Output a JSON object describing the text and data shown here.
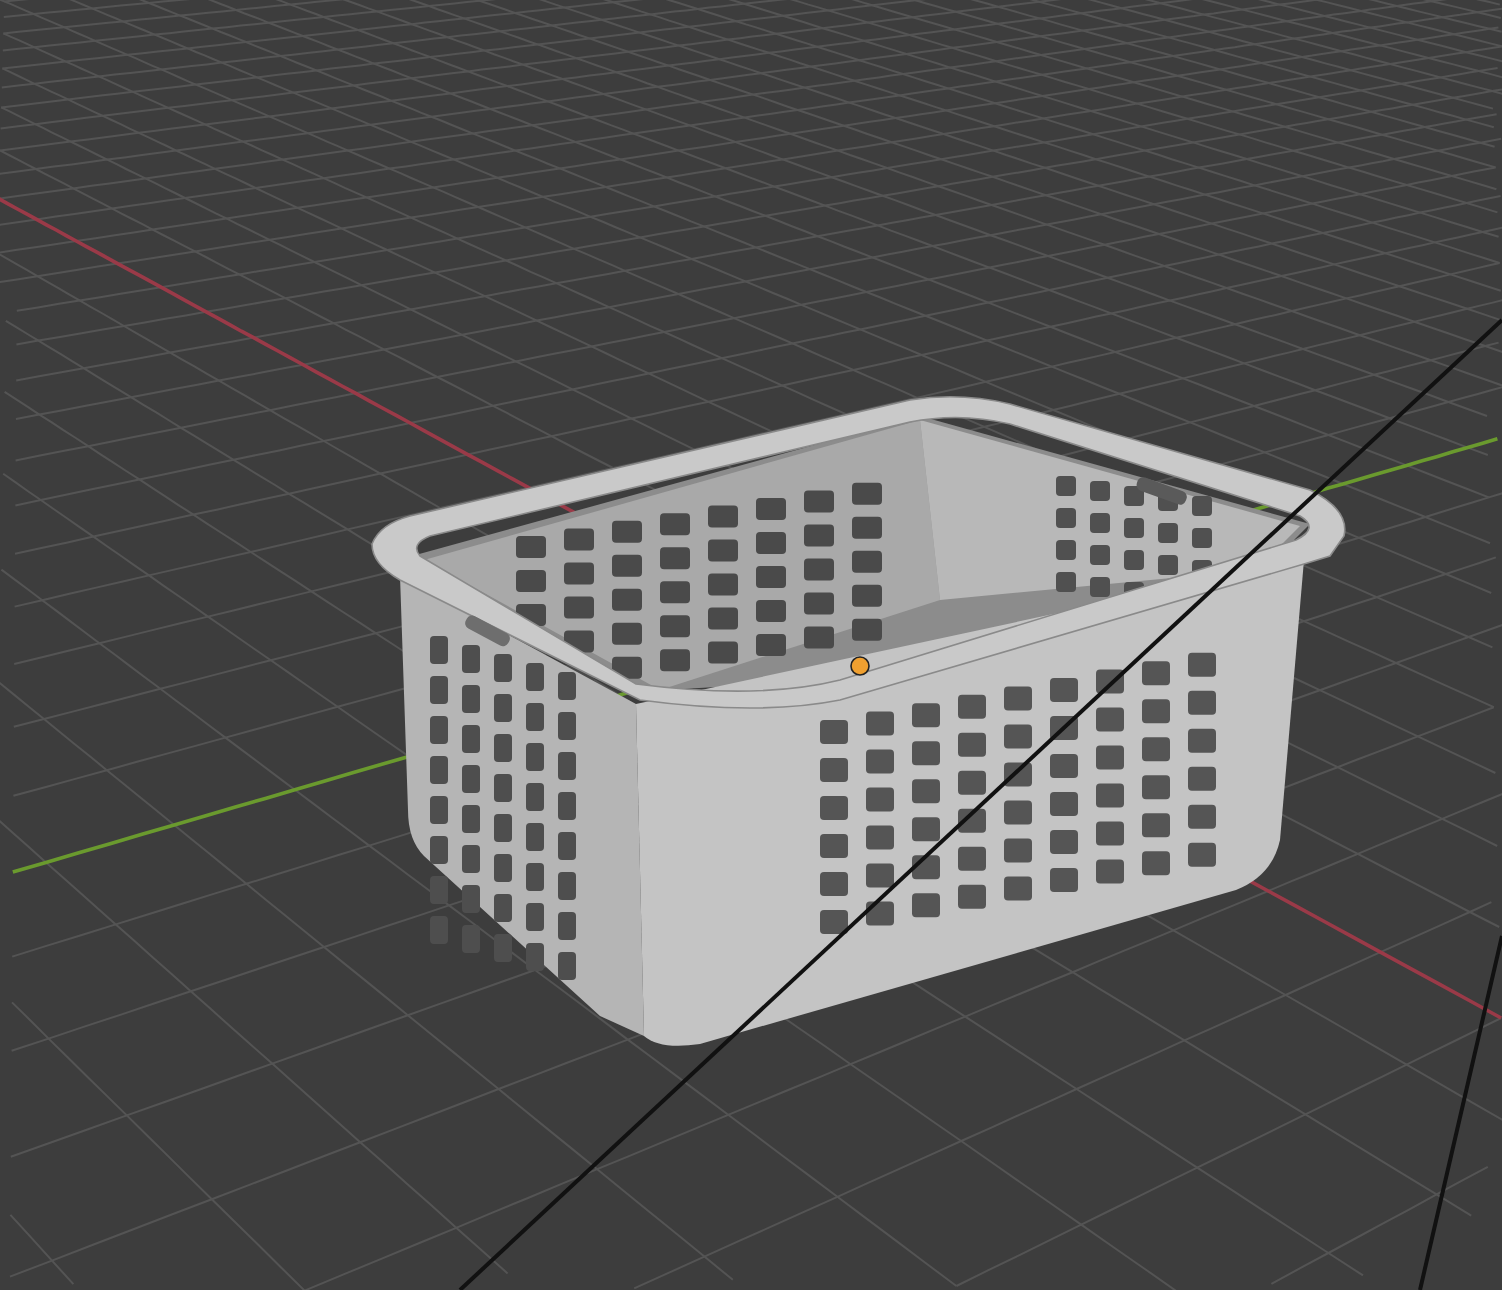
{
  "viewport": {
    "origin_dot": true
  }
}
